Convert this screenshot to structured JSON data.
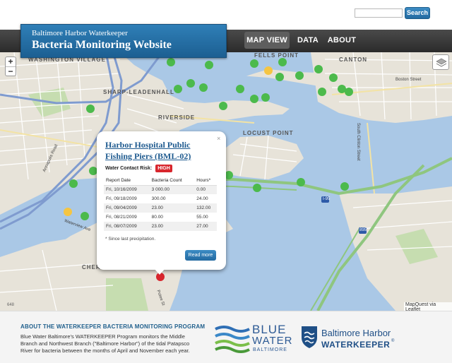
{
  "search": {
    "placeholder": "",
    "button_label": "Search"
  },
  "brand": {
    "line1": "Baltimore Harbor Waterkeeper",
    "line2": "Bacteria Monitoring Website"
  },
  "nav": {
    "items": [
      {
        "label": "MAP VIEW",
        "active": true
      },
      {
        "label": "DATA",
        "active": false
      },
      {
        "label": "ABOUT",
        "active": false
      }
    ]
  },
  "map": {
    "labels": {
      "washington_village": "WASHINGTON VILLAGE",
      "sharp_leadenhall": "SHARP-LEADENHALL",
      "riverside": "RIVERSIDE",
      "locust_point": "LOCUST POINT",
      "fells_point": "FELLS POINT",
      "canton": "CANTON",
      "cherry_hill": "CHERRY HILL"
    },
    "streets": {
      "boston": "Boston Street",
      "south_clinton": "South Clinton Street",
      "annapolis": "Annapolis Road",
      "waterview": "Waterview Ave",
      "potee": "Potee St",
      "route": "I-95",
      "tunnel": "895",
      "tile": "648"
    },
    "attribution": "MapQuest via Leaflet",
    "marker_colors": {
      "low": "#4cba4c",
      "medium": "#f5c542",
      "high": "#d8262d"
    },
    "controls": {
      "zoom_in": "+",
      "zoom_out": "−"
    }
  },
  "popup": {
    "title": "Harbor Hospital Public Fishing Piers (BML-02)",
    "close": "×",
    "risk_label": "Water Contact Risk:",
    "risk_value": "HIGH",
    "table": {
      "headers": [
        "Report Date",
        "Bacteria Count",
        "Hours*"
      ],
      "rows": [
        [
          "Fri, 10/16/2009",
          "3 000.00",
          "0.00"
        ],
        [
          "Fri, 09/18/2009",
          "300.00",
          "24.00"
        ],
        [
          "Fri, 09/04/2009",
          "23.00",
          "132.00"
        ],
        [
          "Fri, 08/21/2009",
          "80.00",
          "55.00"
        ],
        [
          "Fri, 08/07/2009",
          "23.00",
          "27.00"
        ]
      ]
    },
    "footnote": "* Since last precipitation.",
    "button": "Read more"
  },
  "footer": {
    "about_title": "ABOUT THE WATERKEEPER BACTERIA MONITORING PROGRAM",
    "about_body": "Blue Water Baltimore's WATERKEEPER Program monitors the Middle Branch and Northwest Branch (\"Baltimore Harbor\") of the tidal Patapsco River for bacteria between the months of April and November each year.",
    "bw_logo": {
      "line1": "BLUE",
      "line2": "WATER",
      "line3": "BALTIMORE"
    },
    "bh_logo": {
      "line1": "Baltimore Harbor",
      "line2": "WATERKEEPER",
      "mark": "®"
    }
  }
}
